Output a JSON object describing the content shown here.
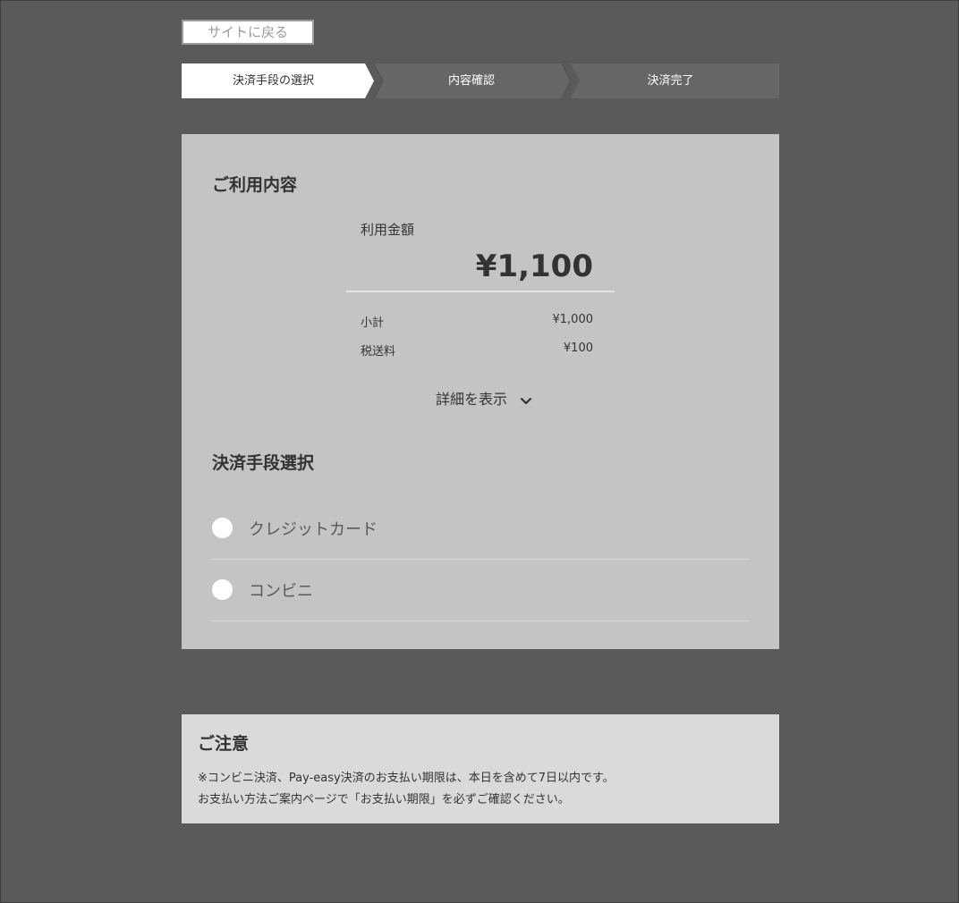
{
  "header": {
    "back_label": "サイトに戻る"
  },
  "steps": [
    {
      "label": "決済手段の選択",
      "active": true
    },
    {
      "label": "内容確認",
      "active": false
    },
    {
      "label": "決済完了",
      "active": false
    }
  ],
  "usage": {
    "heading": "ご利用内容",
    "amount_label": "利用金額",
    "total": "¥1,100",
    "breakdown": [
      {
        "label": "小計",
        "value": "¥1,000"
      },
      {
        "label": "税送料",
        "value": "¥100"
      }
    ],
    "details_toggle": "詳細を表示",
    "details_icon": "chevron-down-icon"
  },
  "payment": {
    "heading": "決済手段選択",
    "options": [
      {
        "label": "クレジットカード",
        "selected": false
      },
      {
        "label": "コンビニ",
        "selected": false
      }
    ]
  },
  "notice": {
    "heading": "ご注意",
    "lines": [
      "※コンビニ決済、Pay-easy決済のお支払い期限は、本日を含めて7日以内です。",
      "お支払い方法ご案内ページで「お支払い期限」を必ずご確認ください。"
    ]
  },
  "colors": {
    "page_background": "#5a5a5a",
    "card_background": "#c4c4c4",
    "notice_background": "#dadada",
    "step_active": "#ffffff",
    "step_inactive": "#666666",
    "text_primary": "#333333"
  }
}
